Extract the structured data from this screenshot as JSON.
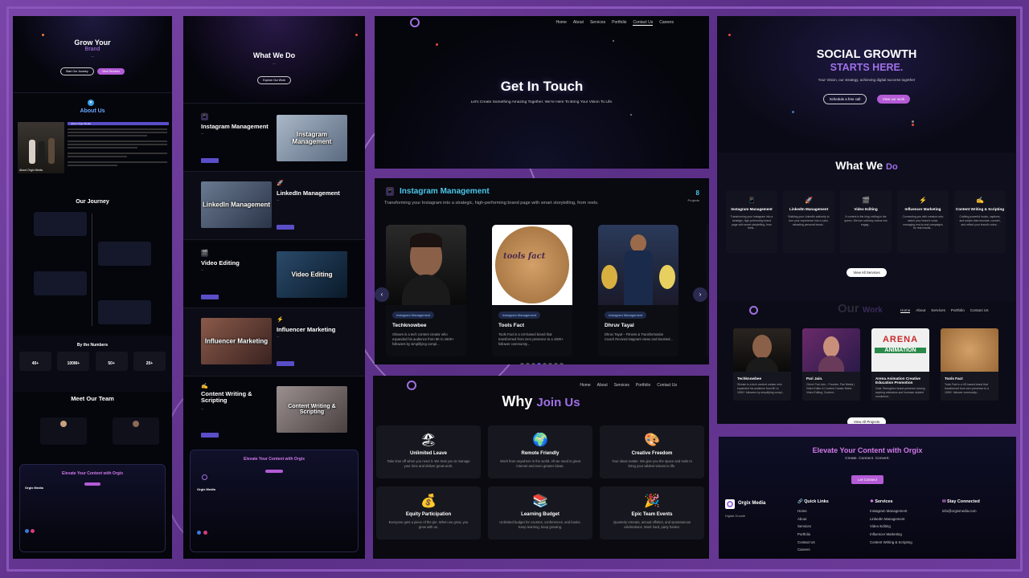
{
  "p1": {
    "hero_title_1": "Grow Your",
    "hero_title_2": "Brand",
    "hero_btn_1": "Start Our Journey",
    "hero_btn_2": "View Services",
    "about_title": "About Us",
    "about_badge": "About Orgix Media",
    "about_caption": "About Orgix Media",
    "journey_title": "Our Journey",
    "numbers_title": "By the Numbers",
    "stats": [
      "40+",
      "100M+",
      "50+",
      "20+"
    ],
    "team_title": "Meet Our Team",
    "cta_title": "Elevate Your Content with Orgix",
    "brand": "Orgix Media"
  },
  "p2": {
    "title": "What We Do",
    "hero_btn": "Explore Our Work",
    "services": [
      {
        "title": "Instagram Management",
        "img": "Instagram Management",
        "icon": "📱"
      },
      {
        "title": "LinkedIn Management",
        "img": "LinkedIn Management",
        "icon": "🚀"
      },
      {
        "title": "Video Editing",
        "img": "Video Editing",
        "icon": "🎬"
      },
      {
        "title": "Influencer Marketing",
        "img": "Influencer Marketing",
        "icon": "⚡"
      },
      {
        "title": "Content Writing & Scripting",
        "img": "Content Writing & Scripting",
        "icon": "✍"
      }
    ],
    "cta_title": "Elevate Your Content with Orgix",
    "brand": "Orgix Media"
  },
  "p3": {
    "nav": [
      "Home",
      "About",
      "Services",
      "Portfolio",
      "Contact Us",
      "Careers"
    ],
    "title": "Get In Touch",
    "subtitle": "Let's Create Something Amazing Together. We're Here To Bring Your Vision To Life."
  },
  "p4": {
    "title": "Instagram Management",
    "subtitle": "Transforming your Instagram into a strategic, high-performing brand page with smart storytelling, from reels.",
    "count": "8",
    "count_label": "Projects",
    "cards": [
      {
        "tag": "Instagram Management",
        "name": "Techknowbee",
        "desc": "Shivam is a tech content creator who expanded his audience from 8K to 150K+ followers by simplifying compl..."
      },
      {
        "tag": "Instagram Management",
        "name": "Tools Fact",
        "desc": "Tools Fact is a US-based brand that transformed from zero presence to a 150K+ follower community..."
      },
      {
        "tag": "Instagram Management",
        "name": "Dhruv Tayal",
        "desc": "Dhruv Tayal – Fitness & Transformation Coach Revived stagnant views and boosted..."
      }
    ],
    "tools_logo": "tools fact"
  },
  "p5": {
    "nav": [
      "Home",
      "About",
      "Services",
      "Portfolio",
      "Contact Us"
    ],
    "title_1": "Why",
    "title_2": "Join Us",
    "cards": [
      {
        "icon": "🏖",
        "title": "Unlimited Leave",
        "desc": "Take time off when you need it. We trust you to manage your time and deliver great work."
      },
      {
        "icon": "🌍",
        "title": "Remote Friendly",
        "desc": "Work from anywhere in the world. All we need is great internet and even greater ideas."
      },
      {
        "icon": "🎨",
        "title": "Creative Freedom",
        "desc": "Your ideas matter. We give you the space and tools to bring your wildest visions to life."
      },
      {
        "icon": "💰",
        "title": "Equity Participation",
        "desc": "Everyone gets a piece of the pie. When we grow, you grow with us."
      },
      {
        "icon": "📚",
        "title": "Learning Budget",
        "desc": "Unlimited budget for courses, conferences, and books. Keep learning, keep growing."
      },
      {
        "icon": "🎉",
        "title": "Epic Team Events",
        "desc": "Quarterly retreats, annual offsites, and spontaneous celebrations. Work hard, party harder."
      }
    ]
  },
  "p6": {
    "title_1": "SOCIAL GROWTH",
    "title_2": "STARTS HERE.",
    "tagline": "Your Vision, our strategy, achieving digital success together",
    "btn_1": "Schedule a free call",
    "btn_2": "View our work",
    "wwd_title_1": "What We",
    "wwd_title_2": "Do",
    "services": [
      {
        "icon": "📱",
        "title": "Instagram Management",
        "desc": "Transforming your Instagram into a strategic, high-performing brand page with smart storytelling, from reels..."
      },
      {
        "icon": "🚀",
        "title": "LinkedIn Management",
        "desc": "Building your LinkedIn authority to turn your experience into a cash-attracting personal brand..."
      },
      {
        "icon": "🎬",
        "title": "Video Editing",
        "desc": "If content is the king, editing is the queen. We turn ordinary videos into engag..."
      },
      {
        "icon": "⚡",
        "title": "Influencer Marketing",
        "desc": "Connecting you with creators who match your brand's voice, managing end-to-end campaigns for real results..."
      },
      {
        "icon": "✍",
        "title": "Content Writing & Scripting",
        "desc": "Crafting powerful hooks, captions, and scripts that resonate, convert, and reflect your brand's voice..."
      }
    ],
    "view_services": "View All Services",
    "our_work_1": "Our",
    "our_work_2": "Work",
    "nav": [
      "Home",
      "About",
      "Services",
      "Portfolio",
      "Contact Us"
    ],
    "works": [
      {
        "name": "Techknowbee",
        "desc": "Shivam is a tech content creator who expanded his audience from 8K to 150K+ followers by simplifying compl..."
      },
      {
        "name": "Pari Jain.",
        "desc": "Client: Pari Jain – Founder, Pari Media | Video Editor & Content Creator Niche: Video Editing, Content..."
      },
      {
        "name": "Arena Animation Creative Education Promotion",
        "desc": "Goal: Strengthen brand presence among aspiring animators and increase student enrollment..."
      },
      {
        "name": "Tools Fact",
        "desc": "Tools Fact is a US-based brand that transformed from zero presence to a 150K+ follower community..."
      }
    ],
    "arena_1": "ARENA",
    "arena_2": "ANIMATION",
    "view_projects": "View All Projects"
  },
  "p7": {
    "title": "Elevate Your Content with Orgix",
    "subtitle": "Create. Connect. Convert.",
    "btn": "Let Connect",
    "brand": "Orgix Media",
    "brand_sub": "Digital Growth",
    "quick_title": "Quick Links",
    "quick": [
      "Home",
      "About",
      "Services",
      "Portfolio",
      "Contact Us",
      "Careers"
    ],
    "services_title": "Services",
    "services": [
      "Instagram Management",
      "LinkedIn Management",
      "Video Editing",
      "Influencer Marketing",
      "Content Writing & Scripting"
    ],
    "connect_title": "Stay Connected",
    "email": "info@orgixmedia.com"
  },
  "colors": {
    "accent": "#b07ae8",
    "frame": "#6b3d96",
    "panel": "#05050c"
  }
}
